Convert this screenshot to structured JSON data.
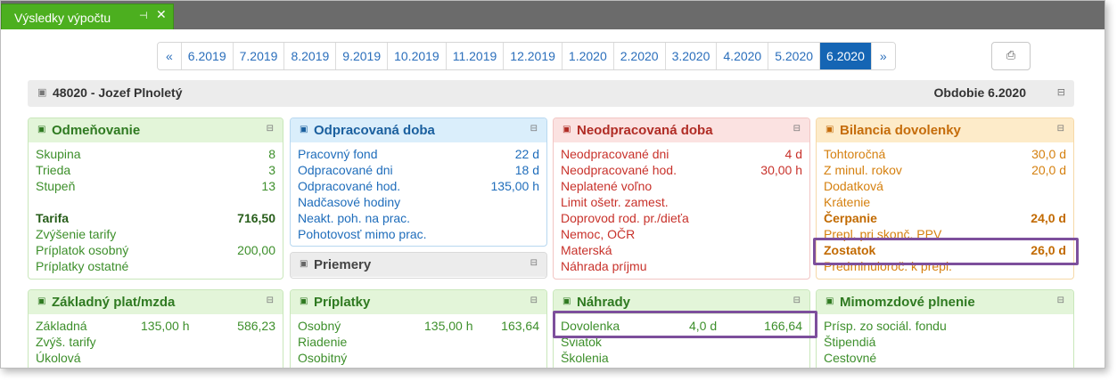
{
  "window": {
    "tab_title": "Výsledky výpočtu",
    "pin_glyph": "⊣",
    "close_glyph": "✕"
  },
  "pager": {
    "prev": "«",
    "next": "»",
    "periods": [
      "6.2019",
      "7.2019",
      "8.2019",
      "9.2019",
      "10.2019",
      "11.2019",
      "12.2019",
      "1.2020",
      "2.2020",
      "3.2020",
      "4.2020",
      "5.2020",
      "6.2020"
    ],
    "active": "6.2020"
  },
  "print_button": {
    "icon": "print-icon",
    "glyph": "⎙"
  },
  "employee": {
    "icon": "user-icon",
    "name": "48020 - Jozef Plnoletý",
    "period_label": "Obdobie 6.2020",
    "collapse_icon": "minimize-icon",
    "collapse_glyph": "⊟"
  },
  "panels": {
    "odmenovanie": {
      "title": "Odmeňovanie",
      "rows": [
        {
          "label": "Skupina",
          "value": "8"
        },
        {
          "label": "Trieda",
          "value": "3"
        },
        {
          "label": "Stupeň",
          "value": "13"
        }
      ],
      "rows2": [
        {
          "label": "Tarifa",
          "value": "716,50",
          "bold": true
        },
        {
          "label": "Zvýšenie tarify",
          "value": ""
        },
        {
          "label": "Príplatok osobný",
          "value": "200,00"
        },
        {
          "label": "Príplatky ostatné",
          "value": ""
        }
      ]
    },
    "odpracovana": {
      "title": "Odpracovaná doba",
      "rows": [
        {
          "label": "Pracovný fond",
          "value": "22 d"
        },
        {
          "label": "Odpracované dni",
          "value": "18 d"
        },
        {
          "label": "Odpracované hod.",
          "value": "135,00 h"
        },
        {
          "label": "Nadčasové hodiny",
          "value": ""
        },
        {
          "label": "Neakt. poh. na prac.",
          "value": ""
        },
        {
          "label": "Pohotovosť mimo prac.",
          "value": ""
        }
      ]
    },
    "priemery": {
      "title": "Priemery"
    },
    "neodpracovana": {
      "title": "Neodpracovaná doba",
      "rows": [
        {
          "label": "Neodpracované dni",
          "value": "4 d"
        },
        {
          "label": "Neodpracované hod.",
          "value": "30,00 h"
        },
        {
          "label": "Neplatené voľno",
          "value": ""
        },
        {
          "label": "Limit ošetr. zamest.",
          "value": ""
        },
        {
          "label": "Doprovod rod. pr./dieťa",
          "value": ""
        },
        {
          "label": "Nemoc, OČR",
          "value": ""
        },
        {
          "label": "Materská",
          "value": ""
        },
        {
          "label": "Náhrada príjmu",
          "value": ""
        }
      ]
    },
    "bilancia": {
      "title": "Bilancia dovolenky",
      "rows": [
        {
          "label": "Tohtoročná",
          "value": "30,0 d"
        },
        {
          "label": "Z minul. rokov",
          "value": "20,0 d"
        },
        {
          "label": "Dodatková",
          "value": ""
        },
        {
          "label": "Krátenie",
          "value": ""
        },
        {
          "label": "Čerpanie",
          "value": "24,0 d",
          "bold": true
        },
        {
          "label": "Prepl. pri skonč. PPV",
          "value": ""
        },
        {
          "label": "Zostatok",
          "value": "26,0 d",
          "bold": true
        },
        {
          "label": "Predminuloroč. k prepl.",
          "value": ""
        }
      ]
    },
    "zakladny": {
      "title": "Základný plat/mzda",
      "rows": [
        {
          "label": "Základná",
          "mid": "135,00 h",
          "value": "586,23"
        },
        {
          "label": "Zvýš. tarify",
          "mid": "",
          "value": ""
        },
        {
          "label": "Úkolová",
          "mid": "",
          "value": ""
        }
      ]
    },
    "priplatky": {
      "title": "Príplatky",
      "rows": [
        {
          "label": "Osobný",
          "mid": "135,00 h",
          "value": "163,64"
        },
        {
          "label": "Riadenie",
          "mid": "",
          "value": ""
        },
        {
          "label": "Osobitný",
          "mid": "",
          "value": ""
        }
      ]
    },
    "nahrady": {
      "title": "Náhrady",
      "rows": [
        {
          "label": "Dovolenka",
          "mid": "4,0 d",
          "value": "166,64"
        },
        {
          "label": "Sviatok",
          "mid": "",
          "value": ""
        },
        {
          "label": "Školenia",
          "mid": "",
          "value": ""
        }
      ]
    },
    "mimomzdove": {
      "title": "Mimomzdové plnenie",
      "rows": [
        {
          "label": "Prísp. zo sociál. fondu",
          "value": ""
        },
        {
          "label": "Štipendiá",
          "value": ""
        },
        {
          "label": "Cestovné",
          "value": ""
        }
      ]
    }
  },
  "icons": {
    "panel_icon_glyph": "▣",
    "panel_close_glyph": "⊟"
  },
  "colors": {
    "tab_green": "#4caf1f",
    "pager_active": "#1565b4",
    "highlight": "#7d4f9c"
  }
}
